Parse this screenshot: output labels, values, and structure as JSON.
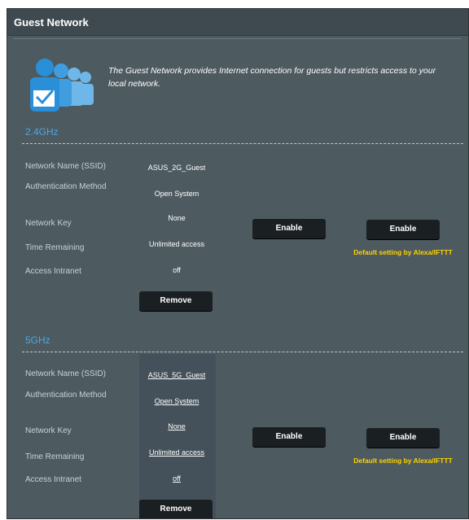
{
  "header": {
    "title": "Guest Network"
  },
  "intro": {
    "text": "The Guest Network provides Internet connection for guests but restricts access to your local network."
  },
  "bands": [
    {
      "title": "2.4GHz",
      "labels": [
        "Network Name (SSID)",
        "Authentication Method",
        "Network Key",
        "Time Remaining",
        "Access Intranet"
      ],
      "values": [
        "ASUS_2G_Guest",
        "Open System",
        "None",
        "Unlimited access",
        "off"
      ],
      "remove_label": "Remove",
      "enable_label": "Enable",
      "enable2_label": "Enable",
      "note": "Default setting by Alexa/IFTTT"
    },
    {
      "title": "5GHz",
      "labels": [
        "Network Name (SSID)",
        "Authentication Method",
        "Network Key",
        "Time Remaining",
        "Access Intranet"
      ],
      "values": [
        "ASUS_5G_Guest",
        "Open System",
        "None",
        "Unlimited access",
        "off"
      ],
      "remove_label": "Remove",
      "enable_label": "Enable",
      "enable2_label": "Enable",
      "note": "Default setting by Alexa/IFTTT"
    }
  ],
  "colors": {
    "accent": "#4aa6e8",
    "note": "#ffd200",
    "panel": "#4d5b60"
  },
  "icons": {
    "intro": "guest-users-check-icon"
  }
}
